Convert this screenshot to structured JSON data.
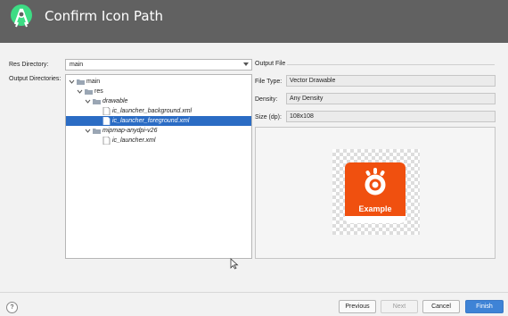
{
  "window": {
    "title": "Confirm Icon Path"
  },
  "form": {
    "res_directory_label": "Res Directory:",
    "res_directory_value": "main",
    "output_directories_label": "Output Directories:"
  },
  "tree": [
    {
      "label": "main",
      "depth": 0,
      "expanded": true,
      "type": "folder"
    },
    {
      "label": "res",
      "depth": 1,
      "expanded": true,
      "type": "folder"
    },
    {
      "label": "drawable",
      "depth": 2,
      "expanded": true,
      "type": "folder"
    },
    {
      "label": "ic_launcher_background.xml",
      "depth": 3,
      "type": "file",
      "selected": false
    },
    {
      "label": "ic_launcher_foreground.xml",
      "depth": 3,
      "type": "file",
      "selected": true
    },
    {
      "label": "mipmap-anydpi-v26",
      "depth": 2,
      "expanded": true,
      "type": "folder"
    },
    {
      "label": "ic_launcher.xml",
      "depth": 3,
      "type": "file"
    }
  ],
  "output": {
    "section_title": "Output File",
    "file_type_label": "File Type:",
    "file_type_value": "Vector Drawable",
    "density_label": "Density:",
    "density_value": "Any Density",
    "size_label": "Size (dp):",
    "size_value": "108x108"
  },
  "preview": {
    "icon_text": "Example",
    "icon_color": "#f0500f"
  },
  "buttons": {
    "help": "?",
    "previous": "Previous",
    "next": "Next",
    "cancel": "Cancel",
    "finish": "Finish"
  },
  "colors": {
    "titlebar": "#616161",
    "selection": "#2b6cc4",
    "primary_button": "#3e83d6",
    "android_green": "#3ddc84"
  }
}
